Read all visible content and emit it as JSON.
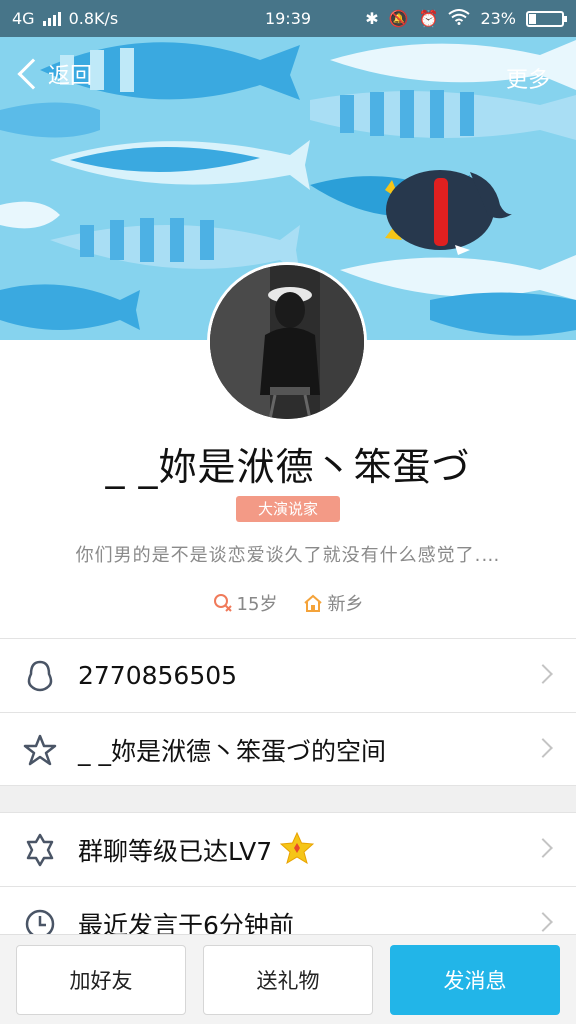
{
  "status_bar": {
    "network": "4G",
    "speed": "0.8K/s",
    "time": "19:39",
    "battery": "23%",
    "battery_level": 0.23,
    "icons": [
      "signal-icon",
      "bluetooth-icon",
      "mute-icon",
      "alarm-icon",
      "wifi-icon",
      "battery-icon"
    ]
  },
  "nav": {
    "back_label": "返回",
    "more_label": "更多"
  },
  "profile": {
    "nickname": "_ _妳是洑德丶笨蛋づ",
    "badge": "大演说家",
    "signature": "你们男的是不是谈恋爱谈久了就没有什么感觉了.…",
    "age": "15岁",
    "hometown": "新乡"
  },
  "rows": {
    "qq_number": "2770856505",
    "space": "_ _妳是洑德丶笨蛋づ的空间",
    "group_level": "群聊等级已达LV7",
    "last_speak": "最近发言于6分钟前"
  },
  "buttons": {
    "add_friend": "加好友",
    "send_gift": "送礼物",
    "send_message": "发消息"
  },
  "colors": {
    "banner": "#7fd0ec",
    "badge": "#f39a86",
    "primary_button": "#22b5e8",
    "penguin_scarf": "#e02020"
  }
}
